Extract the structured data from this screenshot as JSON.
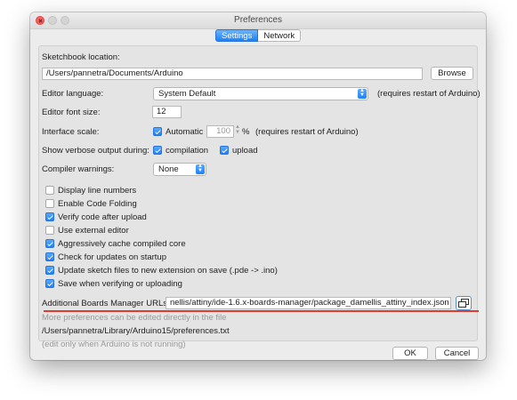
{
  "window": {
    "title": "Preferences"
  },
  "tabs": [
    {
      "label": "Settings",
      "active": true
    },
    {
      "label": "Network",
      "active": false
    }
  ],
  "sketchbook": {
    "label": "Sketchbook location:",
    "path": "/Users/pannetra/Documents/Arduino",
    "browse_label": "Browse"
  },
  "editor_language": {
    "label": "Editor language:",
    "value": "System Default",
    "note": "(requires restart of Arduino)"
  },
  "font_size": {
    "label": "Editor font size:",
    "value": "12"
  },
  "interface_scale": {
    "label": "Interface scale:",
    "automatic_label": "Automatic",
    "automatic_checked": true,
    "value": "100",
    "unit": "%",
    "note": "(requires restart of Arduino)"
  },
  "verbose": {
    "label": "Show verbose output during:",
    "compilation_label": "compilation",
    "compilation_checked": true,
    "upload_label": "upload",
    "upload_checked": true
  },
  "compiler_warnings": {
    "label": "Compiler warnings:",
    "value": "None"
  },
  "options": [
    {
      "label": "Display line numbers",
      "checked": false
    },
    {
      "label": "Enable Code Folding",
      "checked": false
    },
    {
      "label": "Verify code after upload",
      "checked": true
    },
    {
      "label": "Use external editor",
      "checked": false
    },
    {
      "label": "Aggressively cache compiled core",
      "checked": true
    },
    {
      "label": "Check for updates on startup",
      "checked": true
    },
    {
      "label": "Update sketch files to new extension on save (.pde -> .ino)",
      "checked": true
    },
    {
      "label": "Save when verifying or uploading",
      "checked": true
    }
  ],
  "boards_manager": {
    "label": "Additional Boards Manager URLs:",
    "value": "nellis/attiny/ide-1.6.x-boards-manager/package_damellis_attiny_index.json"
  },
  "more_prefs": {
    "note": "More preferences can be edited directly in the file",
    "path": "/Users/pannetra/Library/Arduino15/preferences.txt",
    "hint": "(edit only when Arduino is not running)"
  },
  "footer": {
    "ok_label": "OK",
    "cancel_label": "Cancel"
  },
  "colors": {
    "accent": "#1a82fb",
    "annotation_underline": "#e03c2d"
  }
}
